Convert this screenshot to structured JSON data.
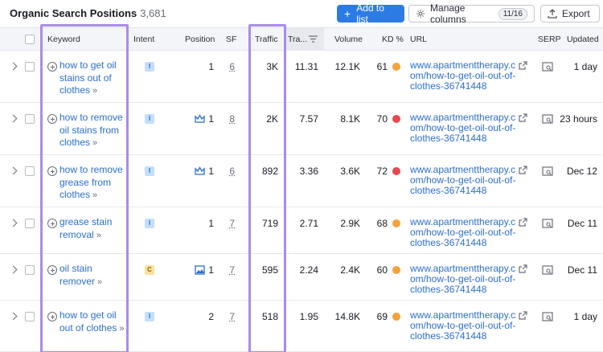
{
  "report": {
    "title": "Organic Search Positions",
    "count": "3,681"
  },
  "toolbar": {
    "add_to_list": "Add to list",
    "manage_columns": "Manage columns",
    "columns_badge": "11/16",
    "export": "Export"
  },
  "columns": {
    "keyword": "Keyword",
    "intent": "Intent",
    "position": "Position",
    "sf": "SF",
    "traffic": "Traffic",
    "traffic_pct": "Tra...",
    "volume": "Volume",
    "kd": "KD %",
    "url": "URL",
    "serp": "SERP",
    "updated": "Updated"
  },
  "colors": {
    "accent": "#2c7be5",
    "highlight": "#a98ce8",
    "kd_orange": "#f4a23c",
    "kd_red": "#e5484d"
  },
  "rows": [
    {
      "keyword": "how to get oil stains out of clothes",
      "intent": "I",
      "position_icon": "",
      "position": "1",
      "sf": "6",
      "traffic": "3K",
      "traffic_pct": "11.31",
      "volume": "12.1K",
      "kd": "61",
      "kd_color": "orange",
      "url": "www.apartmenttherapy.com/how-to-get-oil-out-of-clothes-36741448",
      "updated": "1 day"
    },
    {
      "keyword": "how to remove oil stains from clothes",
      "intent": "I",
      "position_icon": "crown-icon",
      "position": "1",
      "sf": "8",
      "traffic": "2K",
      "traffic_pct": "7.57",
      "volume": "8.1K",
      "kd": "70",
      "kd_color": "red",
      "url": "www.apartmenttherapy.com/how-to-get-oil-out-of-clothes-36741448",
      "updated": "23 hours"
    },
    {
      "keyword": "how to remove grease from clothes",
      "intent": "I",
      "position_icon": "crown-icon",
      "position": "1",
      "sf": "6",
      "traffic": "892",
      "traffic_pct": "3.36",
      "volume": "3.6K",
      "kd": "72",
      "kd_color": "red",
      "url": "www.apartmenttherapy.com/how-to-get-oil-out-of-clothes-36741448",
      "updated": "Dec 12"
    },
    {
      "keyword": "grease stain removal",
      "intent": "I",
      "position_icon": "",
      "position": "1",
      "sf": "7",
      "traffic": "719",
      "traffic_pct": "2.71",
      "volume": "2.9K",
      "kd": "68",
      "kd_color": "orange",
      "url": "www.apartmenttherapy.com/how-to-get-oil-out-of-clothes-36741448",
      "updated": "Dec 11"
    },
    {
      "keyword": "oil stain remover",
      "intent": "C",
      "position_icon": "image-icon",
      "position": "1",
      "sf": "7",
      "traffic": "595",
      "traffic_pct": "2.24",
      "volume": "2.4K",
      "kd": "60",
      "kd_color": "orange",
      "url": "www.apartmenttherapy.com/how-to-get-oil-out-of-clothes-36741448",
      "updated": "Dec 11"
    },
    {
      "keyword": "how to get oil out of clothes",
      "intent": "I",
      "position_icon": "",
      "position": "2",
      "sf": "7",
      "traffic": "518",
      "traffic_pct": "1.95",
      "volume": "14.8K",
      "kd": "69",
      "kd_color": "orange",
      "url": "www.apartmenttherapy.com/how-to-get-oil-out-of-clothes-36741448",
      "updated": "1 day"
    }
  ]
}
